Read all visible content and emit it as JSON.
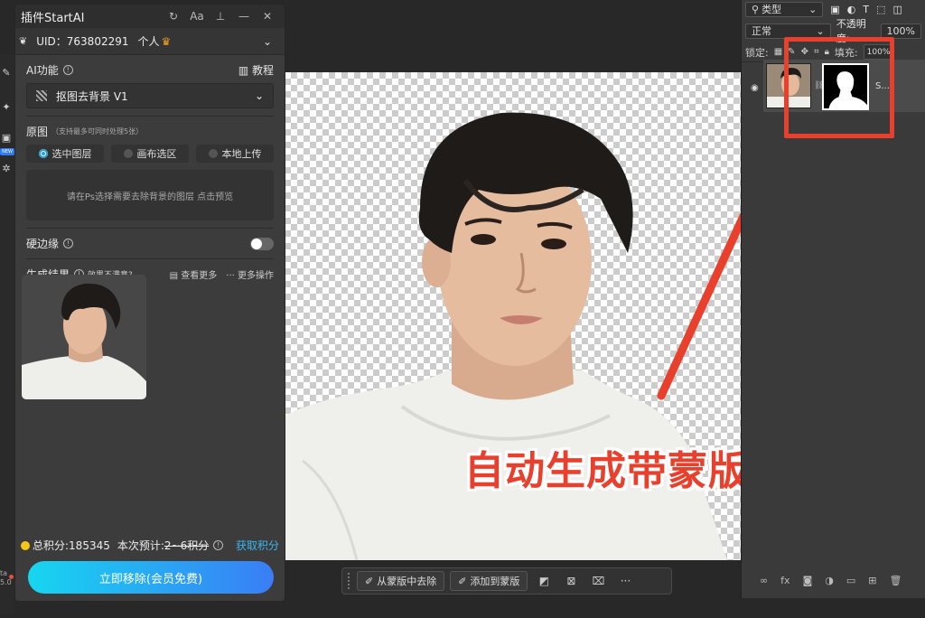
{
  "plugin": {
    "title": "插件StartAI",
    "uid_label": "UID：763802291",
    "tier": "个人",
    "ai_label": "AI功能",
    "tutorial": "教程",
    "function_name": "抠图去背景 V1",
    "source_label": "原图",
    "source_hint": "（支持最多可同时处理5张）",
    "source_options": [
      "选中图层",
      "画布选区",
      "本地上传"
    ],
    "preview_hint": "请在Ps选择需要去除背景的图层 点击预览",
    "hard_edge_label": "硬边缘",
    "result_label": "生成结果",
    "result_feedback": "效果不满意?",
    "view_more": "查看更多",
    "more_actions": "更多操作",
    "points_total": "总积分:185345",
    "points_estimate_label": "本次预计:",
    "points_estimate_value": "2~6积分",
    "get_points": "获取积分",
    "cta": "立即移除(会员免费)",
    "new_badge": "NEW"
  },
  "canvas_caption": "自动生成带蒙版图层",
  "mask_toolbar": {
    "remove_from_mask": "从蒙版中去除",
    "add_to_mask": "添加到蒙版"
  },
  "layers_panel": {
    "filter_kind": "类型",
    "blend_mode": "正常",
    "opacity_label": "不透明度:",
    "opacity_value": "100%",
    "lock_label": "锁定:",
    "fill_label": "填充:",
    "fill_value": "100%",
    "layer_name": "S...",
    "footer_fx": "fx"
  },
  "strip": {
    "bottom_line1": "ta",
    "bottom_line2": "5.0"
  },
  "colors": {
    "accent_red": "#e8402c",
    "cta_gradient_start": "#17d6f0",
    "cta_gradient_end": "#3a7df6",
    "link_blue": "#3bb6f0"
  }
}
